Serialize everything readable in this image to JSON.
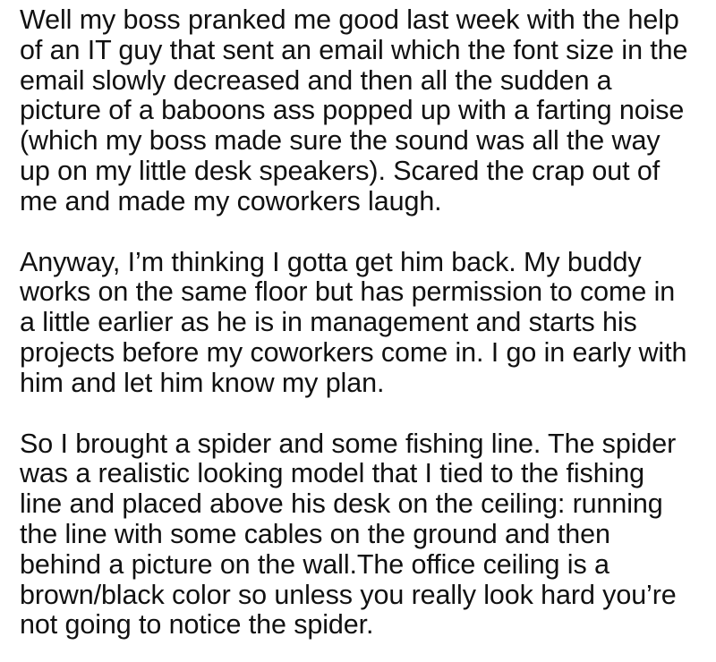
{
  "paragraphs": [
    {
      "lines": [
        "Well my boss pranked me good last week with the help",
        "of an IT guy that sent an email which the font size in the",
        "email slowly decreased and then all the sudden a",
        "picture of a baboons ass popped up with a farting noise",
        "(which my boss made sure the sound was all the way",
        "up on my little desk speakers). Scared the crap out of",
        "me and made my coworkers laugh."
      ]
    },
    {
      "lines": [
        "Anyway, I’m thinking I gotta get him back. My buddy",
        "works on the same floor but has permission to come in",
        "a little earlier as he is in management and starts his",
        "projects before my coworkers come in. I go in early with",
        "him and let him know my plan."
      ]
    },
    {
      "lines": [
        "So I brought a spider and some fishing line. The spider",
        "was a realistic looking model that I tied to the fishing",
        "line and placed above his desk on the ceiling: running",
        "the line with some cables on the ground and then",
        "behind a picture on the wall.The office ceiling is a",
        "brown/black color so unless you really look hard you’re",
        "not going to notice the spider."
      ]
    }
  ]
}
